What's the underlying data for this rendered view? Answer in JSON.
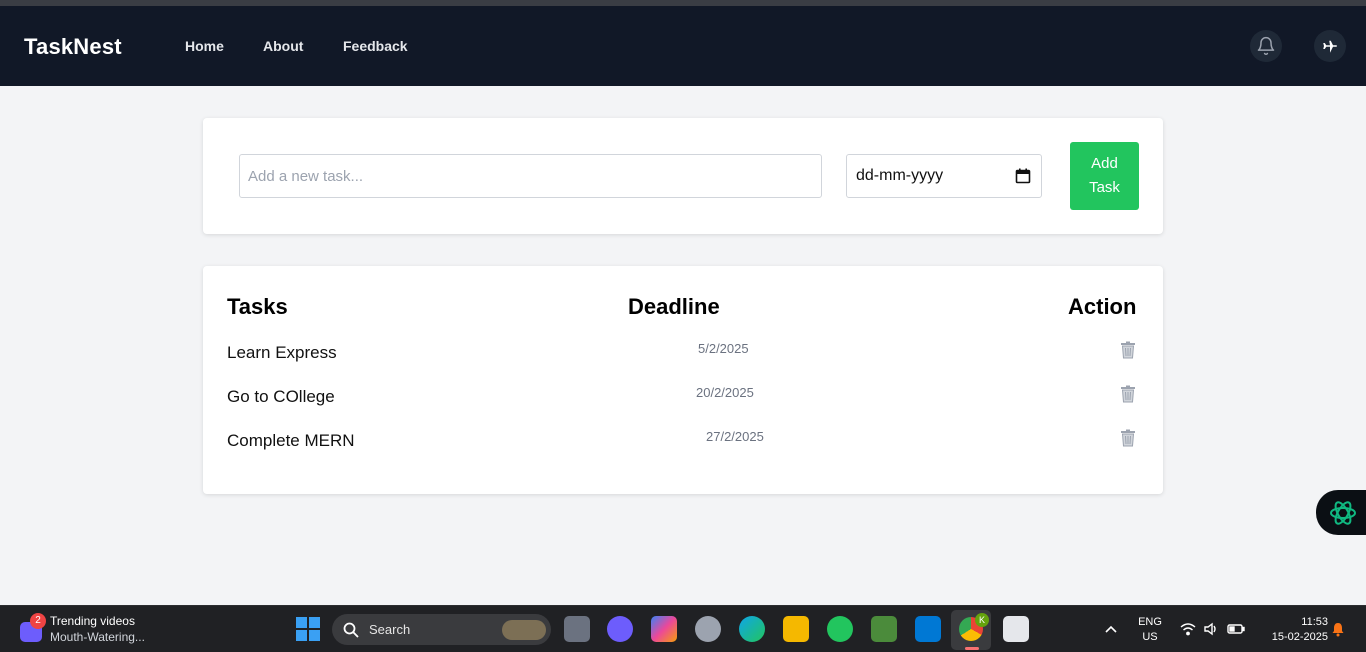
{
  "navbar": {
    "brand": "TaskNest",
    "links": [
      "Home",
      "About",
      "Feedback"
    ]
  },
  "add_form": {
    "task_placeholder": "Add a new task...",
    "date_placeholder": "dd-mm-yyyy",
    "add_button": "Add Task"
  },
  "table": {
    "headers": [
      "Tasks",
      "Deadline",
      "Action"
    ],
    "rows": [
      {
        "task": "Learn Express",
        "deadline": "5/2/2025"
      },
      {
        "task": "Go to COllege",
        "deadline": "20/2/2025"
      },
      {
        "task": "Complete MERN",
        "deadline": "27/2/2025"
      }
    ]
  },
  "taskbar": {
    "widget_badge": "2",
    "widget_title": "Trending videos",
    "widget_subtitle": "Mouth-Watering...",
    "search_label": "Search",
    "chrome_badge": "K",
    "lang_line1": "ENG",
    "lang_line2": "US",
    "time": "11:53",
    "date": "15-02-2025"
  },
  "colors": {
    "navbar": "#111827",
    "page_bg": "#f3f4f6",
    "add_button": "#22c55e"
  }
}
